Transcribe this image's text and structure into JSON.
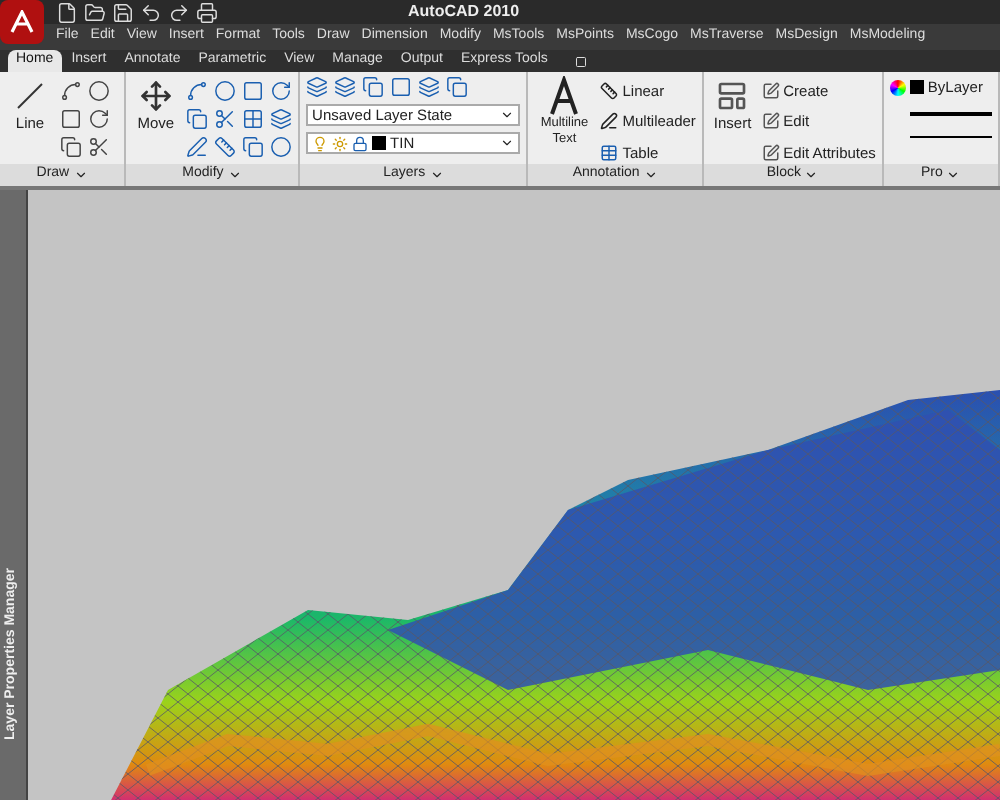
{
  "window": {
    "title": "AutoCAD 2010"
  },
  "menu": [
    "File",
    "Edit",
    "View",
    "Insert",
    "Format",
    "Tools",
    "Draw",
    "Dimension",
    "Modify",
    "MsTools",
    "MsPoints",
    "MsCogo",
    "MsTraverse",
    "MsDesign",
    "MsModeling"
  ],
  "tabs": [
    {
      "label": "Home",
      "selected": true
    },
    {
      "label": "Insert",
      "selected": false
    },
    {
      "label": "Annotate",
      "selected": false
    },
    {
      "label": "Parametric",
      "selected": false
    },
    {
      "label": "View",
      "selected": false
    },
    {
      "label": "Manage",
      "selected": false
    },
    {
      "label": "Output",
      "selected": false
    },
    {
      "label": "Express Tools",
      "selected": false
    }
  ],
  "panels": {
    "draw": {
      "label": "Draw",
      "tool": "Line"
    },
    "modify": {
      "label": "Modify",
      "tool": "Move"
    },
    "layers": {
      "label": "Layers",
      "layer_state": "Unsaved Layer State",
      "current_layer": "TIN"
    },
    "annotation": {
      "label": "Annotation",
      "big_tool": "Multiline Text",
      "tools": [
        "Linear",
        "Multileader",
        "Table"
      ]
    },
    "block": {
      "label": "Block",
      "big_tool": "Insert",
      "tools": [
        "Create",
        "Edit",
        "Edit Attributes"
      ]
    },
    "properties": {
      "label": "Pro",
      "color_value": "ByLayer"
    }
  },
  "palette": {
    "title": "Layer Properties Manager"
  }
}
